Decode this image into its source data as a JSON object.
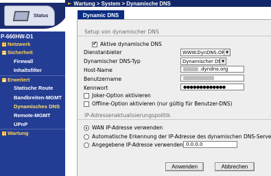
{
  "nav": {
    "status_label": "Status",
    "device": "P-660HW-D1",
    "items": [
      {
        "label": "Netzwerk"
      },
      {
        "label": "Sicherheit"
      },
      {
        "label": "Firewall"
      },
      {
        "label": "Inhaltsfilter"
      },
      {
        "label": "Erweitert"
      },
      {
        "label": "Statische Route"
      },
      {
        "label": "Bandbreiten-MGMT"
      },
      {
        "label": "Dynamisches DNS"
      },
      {
        "label": "Remote-MGMT"
      },
      {
        "label": "UPnP"
      },
      {
        "label": "Wartung"
      }
    ]
  },
  "topbar": {
    "breadcrumb": "Wartung > System > Dynamische DNS"
  },
  "tab": {
    "label": "Dynamic DNS"
  },
  "setup": {
    "title": "Setup von dynamischer DNS",
    "enable_label": "Aktive dynamische DNS",
    "provider_label": "Dienstanbieter",
    "provider_value": "WWW.DynDNS.ORG",
    "type_label": "Dynamischer DNS-Typ",
    "type_value": "Dynamischer DNS",
    "host_label": "Host-Name",
    "host_value": ".dyndns.org",
    "user_label": "Benutzername",
    "password_label": "Kennwort",
    "password_value": "●●●●●●●●●●●●●",
    "joker_label": "Joker-Option aktivieren",
    "offline_label": "Offline-Option aktivieren (nur gültig für Benutzer-DNS)"
  },
  "ip": {
    "title": "IP-Adressenaktualisierungspolitik",
    "option1": "WAN IP-Adresse verwenden",
    "option2": "Automatische Erkennung der IP-Adresse des dynamischen DNS-Servers",
    "option3": "Angegebene IP-Adresse verwenden",
    "ip_value": "0.0.0.0"
  },
  "buttons": {
    "apply": "Anwenden",
    "cancel": "Abbrechen"
  },
  "colors": {
    "nav_bg": "#243d94",
    "accent": "#0a2d84",
    "section_text": "#ffd25a"
  }
}
